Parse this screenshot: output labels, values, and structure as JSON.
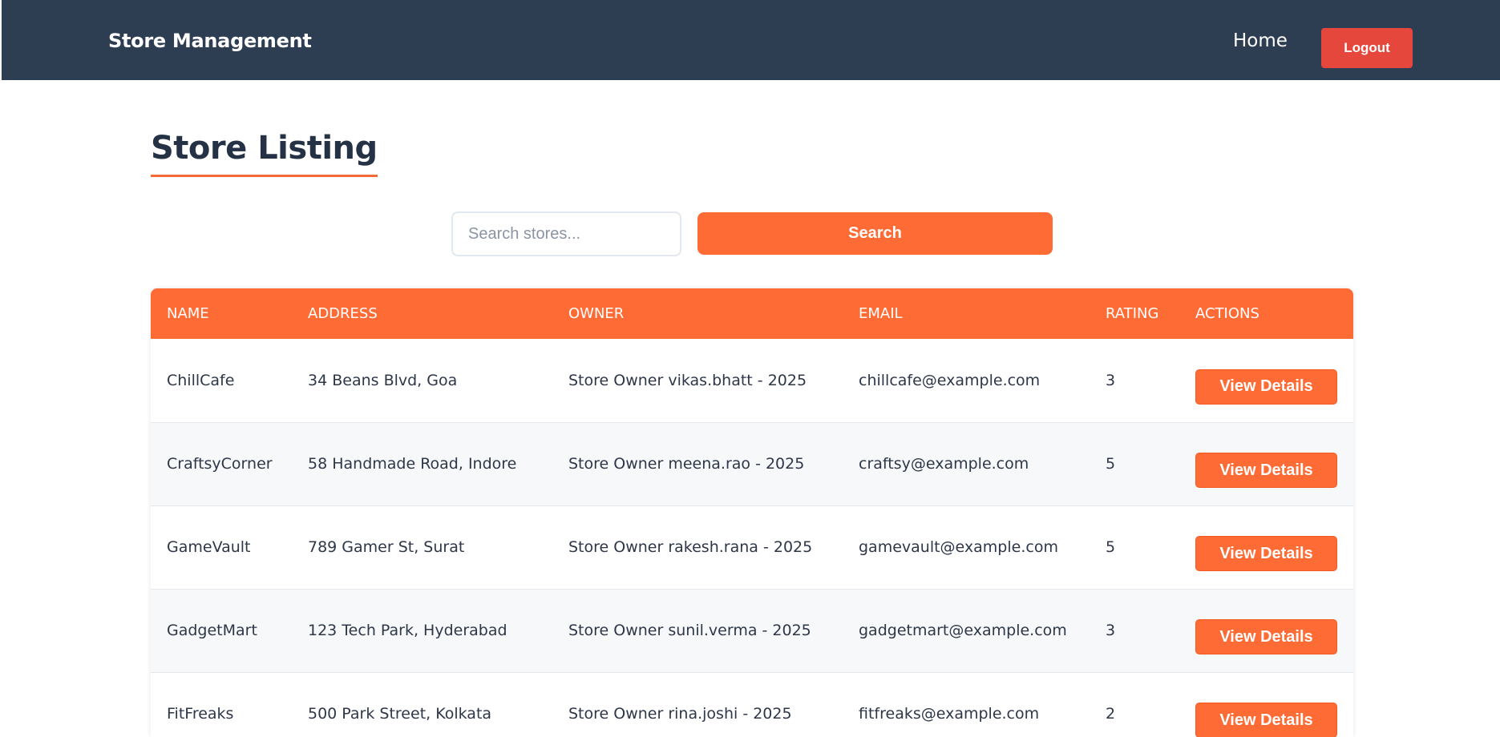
{
  "header": {
    "brand": "Store Management",
    "nav_home": "Home",
    "logout_label": "Logout"
  },
  "page": {
    "title": "Store Listing"
  },
  "search": {
    "placeholder": "Search stores...",
    "value": "",
    "button_label": "Search"
  },
  "table": {
    "columns": [
      "NAME",
      "ADDRESS",
      "OWNER",
      "EMAIL",
      "RATING",
      "ACTIONS"
    ],
    "action_label": "View Details",
    "rows": [
      {
        "name": "ChillCafe",
        "address": "34 Beans Blvd, Goa",
        "owner": "Store Owner vikas.bhatt - 2025",
        "email": "chillcafe@example.com",
        "rating": "3"
      },
      {
        "name": "CraftsyCorner",
        "address": "58 Handmade Road, Indore",
        "owner": "Store Owner meena.rao - 2025",
        "email": "craftsy@example.com",
        "rating": "5"
      },
      {
        "name": "GameVault",
        "address": "789 Gamer St, Surat",
        "owner": "Store Owner rakesh.rana - 2025",
        "email": "gamevault@example.com",
        "rating": "5"
      },
      {
        "name": "GadgetMart",
        "address": "123 Tech Park, Hyderabad",
        "owner": "Store Owner sunil.verma - 2025",
        "email": "gadgetmart@example.com",
        "rating": "3"
      },
      {
        "name": "FitFreaks",
        "address": "500 Park Street, Kolkata",
        "owner": "Store Owner rina.joshi - 2025",
        "email": "fitfreaks@example.com",
        "rating": "2"
      }
    ]
  },
  "colors": {
    "navbar": "#2e3e52",
    "accent": "#ff6b35",
    "logout": "#e5473c"
  }
}
